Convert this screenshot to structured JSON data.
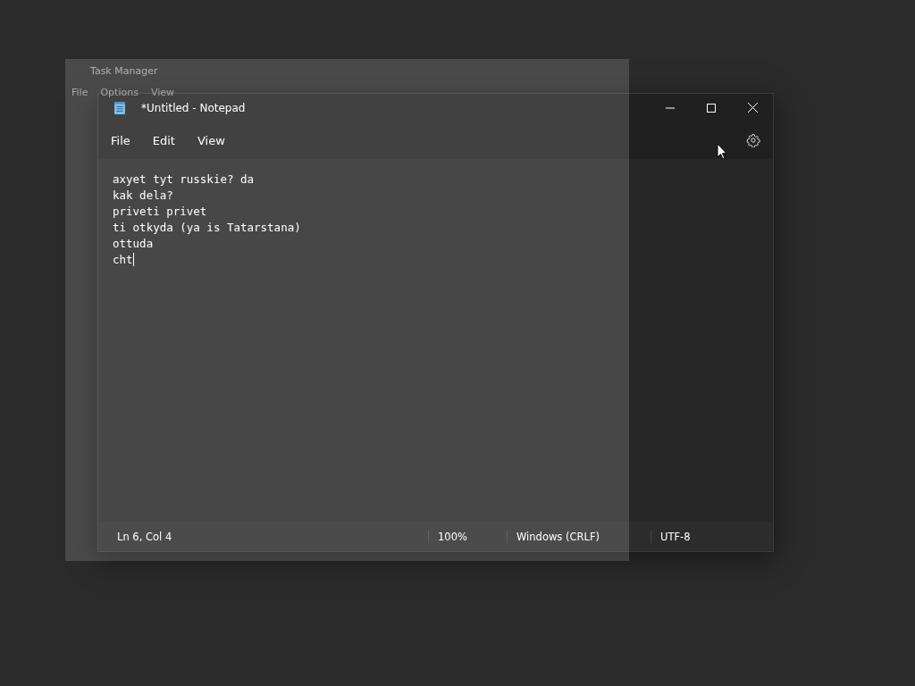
{
  "task_manager": {
    "title": "Task Manager",
    "menu": [
      "File",
      "Options",
      "View"
    ]
  },
  "notepad": {
    "title": "*Untitled - Notepad",
    "menu": [
      "File",
      "Edit",
      "View"
    ],
    "lines": [
      "axyet tyt russkie? da",
      "kak dela?",
      "priveti privet",
      "ti otkyda (ya is Tatarstana)",
      "ottuda",
      "cht"
    ],
    "status_bar": {
      "position": "Ln 6, Col 4",
      "zoom": "100%",
      "line_ending": "Windows (CRLF)",
      "encoding": "UTF-8"
    }
  }
}
